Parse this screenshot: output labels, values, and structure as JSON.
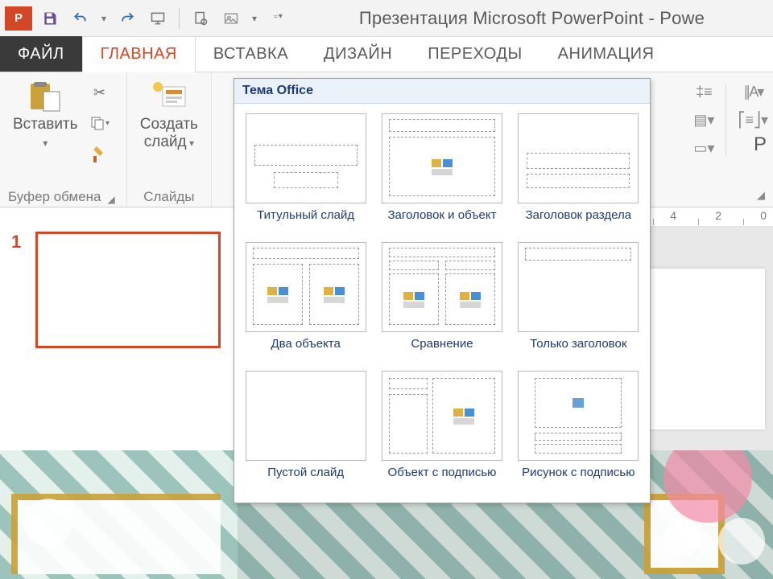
{
  "title": "Презентация Microsoft PowerPoint - Powe",
  "tabs": {
    "file": "ФАЙЛ",
    "home": "ГЛАВНАЯ",
    "insert": "ВСТАВКА",
    "design": "ДИЗАЙН",
    "transitions": "ПЕРЕХОДЫ",
    "animation": "АНИМАЦИЯ"
  },
  "ribbon": {
    "clipboard": {
      "paste": "Вставить",
      "label": "Буфер обмена"
    },
    "slides": {
      "new_slide": "Создать\nслайд",
      "label": "Слайды"
    },
    "right_label": "Р"
  },
  "slide_panel": {
    "current": "1"
  },
  "ruler": {
    "m4": "4",
    "m2": "2",
    "m0": "0"
  },
  "gallery": {
    "header": "Тема Office",
    "layouts": [
      "Титульный слайд",
      "Заголовок и объект",
      "Заголовок раздела",
      "Два объекта",
      "Сравнение",
      "Только заголовок",
      "Пустой слайд",
      "Объект с подписью",
      "Рисунок с подписью"
    ]
  }
}
